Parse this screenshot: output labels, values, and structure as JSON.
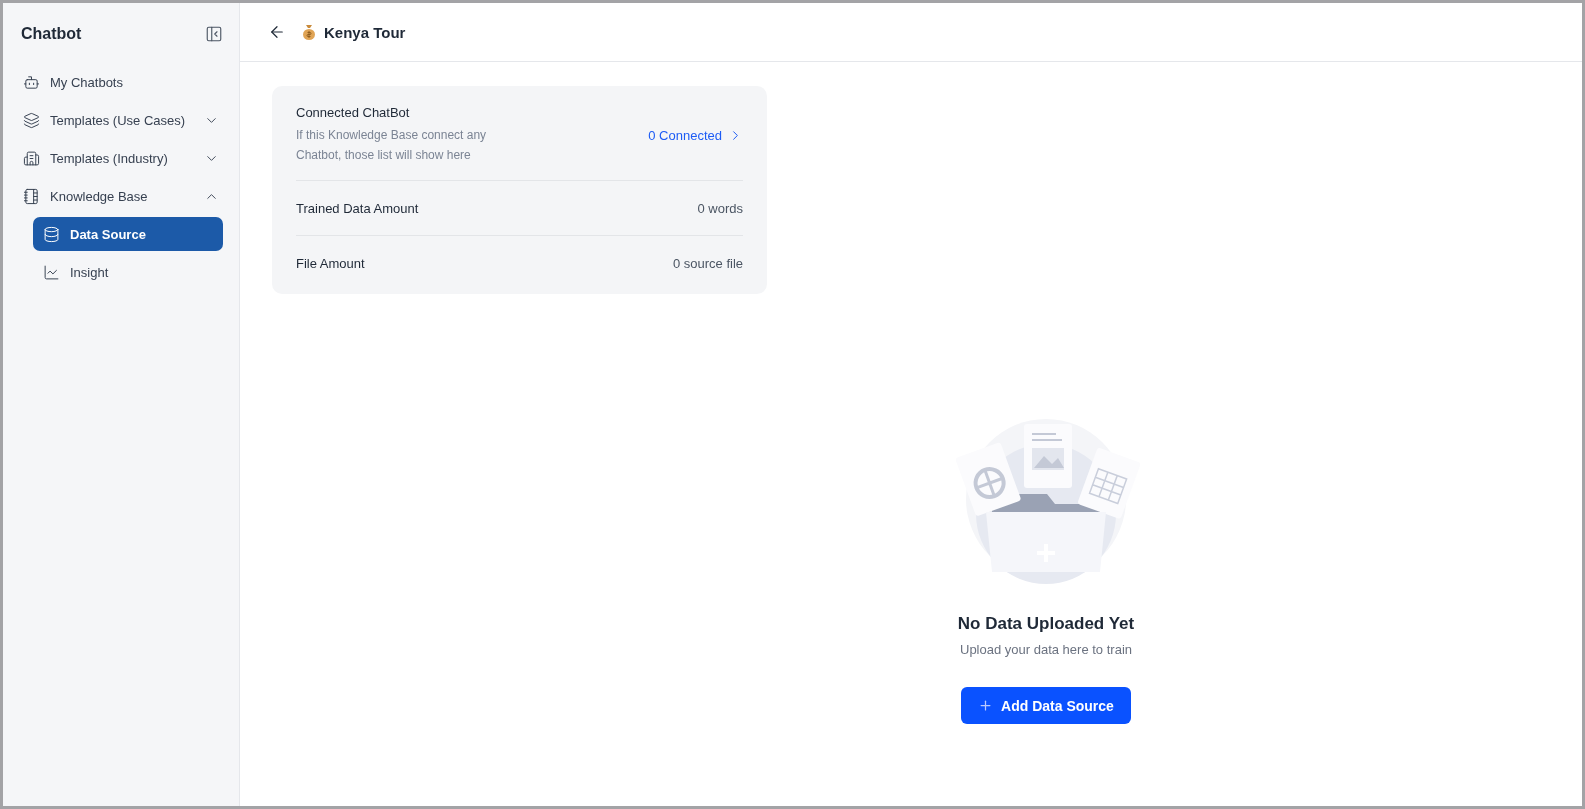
{
  "sidebar": {
    "title": "Chatbot",
    "items": [
      {
        "label": "My Chatbots",
        "kind": "link",
        "selected": false
      },
      {
        "label": "Templates (Use Cases)",
        "kind": "group",
        "expanded": false
      },
      {
        "label": "Templates (Industry)",
        "kind": "group",
        "expanded": false
      },
      {
        "label": "Knowledge Base",
        "kind": "group",
        "expanded": true,
        "children": [
          {
            "label": "Data Source",
            "selected": true
          },
          {
            "label": "Insight",
            "selected": false
          }
        ]
      }
    ]
  },
  "header": {
    "title": "Kenya Tour"
  },
  "summary": {
    "rows": [
      {
        "label": "Connected ChatBot",
        "description": "If this Knowledge Base connect any Chatbot, those list will show here",
        "value": "0 Connected",
        "kind": "link"
      },
      {
        "label": "Trained Data Amount",
        "value": "0 words",
        "kind": "plain"
      },
      {
        "label": "File Amount",
        "value": "0 source file",
        "kind": "plain"
      }
    ]
  },
  "empty_state": {
    "title": "No Data Uploaded Yet",
    "subtitle": "Upload your data here to train",
    "button": "Add Data Source"
  }
}
